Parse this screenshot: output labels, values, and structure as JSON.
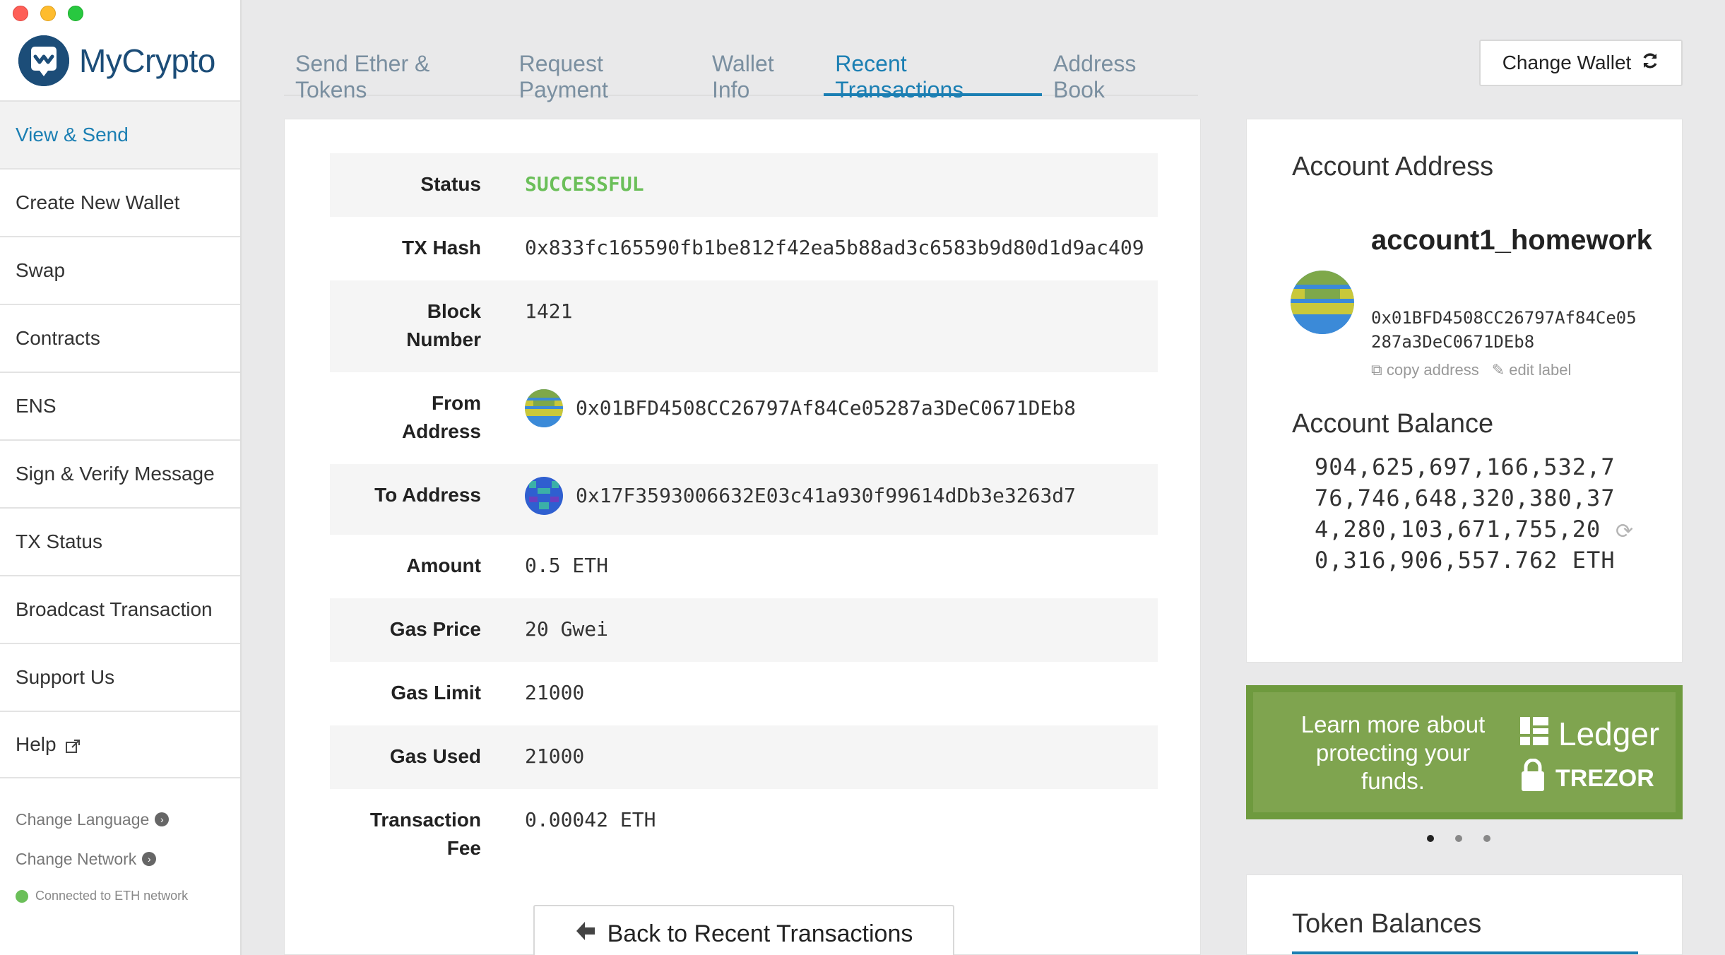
{
  "app": {
    "logo_text": "MyCrypto"
  },
  "sidebar": {
    "items": [
      {
        "label": "View & Send",
        "active": true
      },
      {
        "label": "Create New Wallet"
      },
      {
        "label": "Swap"
      },
      {
        "label": "Contracts"
      },
      {
        "label": "ENS"
      },
      {
        "label": "Sign & Verify Message"
      },
      {
        "label": "TX Status"
      },
      {
        "label": "Broadcast Transaction"
      },
      {
        "label": "Support Us"
      },
      {
        "label": "Help",
        "icon": "external-link-icon"
      }
    ],
    "change_language": "Change Language",
    "change_network": "Change Network",
    "connection_status": "Connected to ETH network"
  },
  "tabs": [
    {
      "label": "Send Ether & Tokens"
    },
    {
      "label": "Request Payment"
    },
    {
      "label": "Wallet Info"
    },
    {
      "label": "Recent Transactions",
      "active": true
    },
    {
      "label": "Address Book"
    }
  ],
  "header": {
    "change_wallet": "Change Wallet"
  },
  "tx": {
    "status_label": "Status",
    "status_value": "SUCCESSFUL",
    "hash_label": "TX Hash",
    "hash_value": "0x833fc165590fb1be812f42ea5b88ad3c6583b9d80d1d9ac409",
    "block_label_1": "Block",
    "block_label_2": "Number",
    "block_value": "1421",
    "from_label_1": "From",
    "from_label_2": "Address",
    "from_value": "0x01BFD4508CC26797Af84Ce05287a3DeC0671DEb8",
    "to_label": "To Address",
    "to_value": "0x17F3593006632E03c41a930f99614dDb3e3263d7",
    "amount_label": "Amount",
    "amount_value": "0.5 ETH",
    "gas_price_label": "Gas Price",
    "gas_price_value": "20 Gwei",
    "gas_limit_label": "Gas Limit",
    "gas_limit_value": "21000",
    "gas_used_label": "Gas Used",
    "gas_used_value": "21000",
    "fee_label_1": "Transaction",
    "fee_label_2": "Fee",
    "fee_value": "0.00042 ETH",
    "back_button": "Back to Recent Transactions"
  },
  "account": {
    "heading": "Account Address",
    "name": "account1_homework",
    "address": "0x01BFD4508CC26797Af84Ce05287a3DeC0671DEb8",
    "copy_address": "copy address",
    "edit_label": "edit label",
    "balance_heading": "Account Balance",
    "balance": "904,625,697,166,532,776,746,648,320,380,374,280,103,671,755,200,316,906,557.762 ETH"
  },
  "promo": {
    "text": "Learn more about protecting your funds.",
    "ledger": "Ledger",
    "trezor": "TREZOR",
    "colors": {
      "bg": "#7fa44f",
      "border": "#6e9a3e"
    }
  },
  "tokens": {
    "heading": "Token Balances"
  },
  "colors": {
    "accent": "#1b7fb3",
    "success": "#6bbf59",
    "brand": "#1c4d78"
  }
}
